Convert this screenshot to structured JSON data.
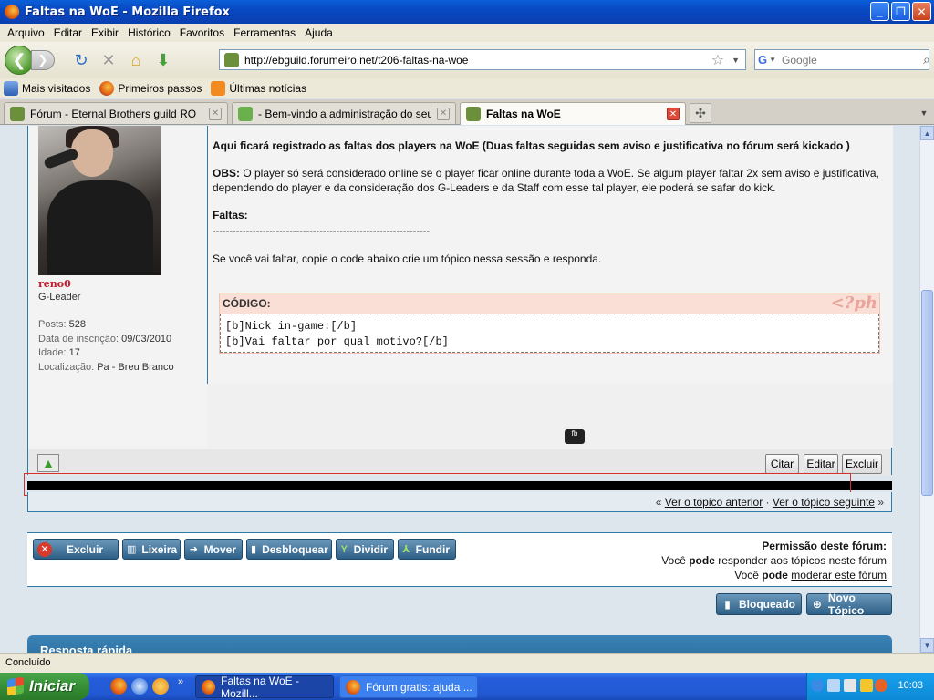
{
  "window": {
    "title": "Faltas na WoE - Mozilla Firefox",
    "buttons": {
      "minimize": "_",
      "maximize": "❐",
      "close": "✕"
    }
  },
  "menu": [
    "Arquivo",
    "Editar",
    "Exibir",
    "Histórico",
    "Favoritos",
    "Ferramentas",
    "Ajuda"
  ],
  "toolbar": {
    "url": "http://ebguild.forumeiro.net/t206-faltas-na-woe",
    "search_placeholder": "Google",
    "search_engine_letter": "G"
  },
  "bookmarks": [
    "Mais visitados",
    "Primeiros passos",
    "Últimas notícias"
  ],
  "tabs": [
    {
      "label": "Fórum - Eternal Brothers guild RO"
    },
    {
      "label": "- Bem-vindo a administração do seu fór..."
    },
    {
      "label": "Faltas na WoE"
    }
  ],
  "profile": {
    "username": "reno0",
    "rank": "G-Leader",
    "posts_label": "Posts:",
    "posts": "528",
    "joined_label": "Data de inscrição:",
    "joined": "09/03/2010",
    "age_label": "Idade:",
    "age": "17",
    "location_label": "Localização:",
    "location": "Pa - Breu Branco"
  },
  "post": {
    "intro": "Aqui ficará registrado as faltas dos players na WoE (Duas faltas seguidas sem aviso e justificativa no fórum será kickado )",
    "obs_label": "OBS:",
    "obs_text": "O player só será considerado online se o player ficar online durante toda a WoE. Se algum player faltar 2x sem aviso e justificativa, dependendo do player e da consideração dos G-Leaders e da Staff com esse tal player, ele poderá se safar do kick.",
    "faltas_label": "Faltas:",
    "separator": "-----------------------------------------------------------------",
    "instruction": "Se você vai faltar, copie o code abaixo crie um tópico nessa sessão e responda.",
    "code_label": "CÓDIGO:",
    "code_logo": "<?ph",
    "code_lines": [
      "[b]Nick in-game:[/b]",
      "[b]Vai faltar por qual motivo?[/b]"
    ],
    "chat_badge": "fb"
  },
  "post_actions": {
    "quote": "Citar",
    "edit": "Editar",
    "delete": "Excluir"
  },
  "topic_nav": {
    "prefix": "«",
    "previous": "Ver o tópico anterior",
    "sep": "·",
    "next": "Ver o tópico seguinte",
    "suffix": "»"
  },
  "mod_buttons": [
    "Excluir",
    "Lixeira",
    "Mover",
    "Desbloquear",
    "Dividir",
    "Fundir"
  ],
  "permissions": {
    "title": "Permissão deste fórum:",
    "line1_pre": "Você ",
    "line1_bold": "pode",
    "line1_post": " responder aos tópicos neste fórum",
    "line2_pre": "Você ",
    "line2_bold": "pode",
    "line2_link": "moderar este fórum"
  },
  "topic_buttons": {
    "locked": "Bloqueado",
    "new_topic": "Novo Tópico"
  },
  "quick_reply": "Resposta rápida",
  "status": "Concluído",
  "taskbar": {
    "start": "Iniciar",
    "tasks": [
      "Faltas na WoE - Mozill...",
      "Fórum gratis: ajuda ..."
    ],
    "clock": "10:03"
  },
  "colors": {
    "accent": "#2e7ca6",
    "username": "#c41d2e"
  }
}
